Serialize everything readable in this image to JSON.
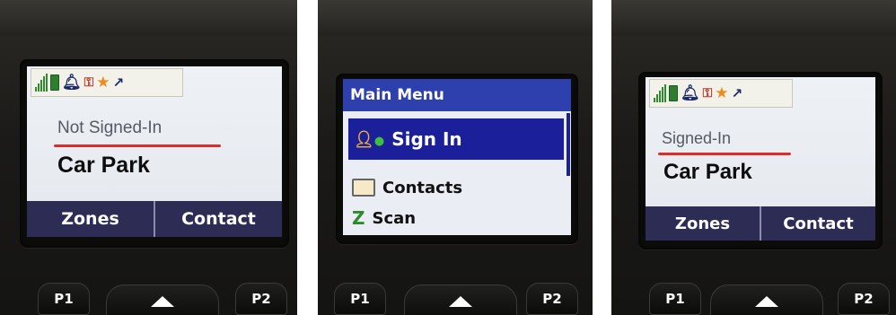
{
  "panels": [
    {
      "status_label": "Not Signed-In",
      "zone_name": "Car Park",
      "softkeys": [
        "Zones",
        "Contact"
      ],
      "keys": {
        "left": "P1",
        "right": "P2"
      }
    },
    {
      "menu_title": "Main Menu",
      "menu_items": [
        {
          "label": "Sign In",
          "icon": "sign-in-person-icon",
          "selected": true
        },
        {
          "label": "Contacts",
          "icon": "contacts-card-icon",
          "selected": false
        },
        {
          "label": "Scan",
          "icon": "scan-z-icon",
          "selected": false
        }
      ],
      "keys": {
        "left": "P1",
        "right": "P2"
      }
    },
    {
      "status_label": "Signed-In",
      "zone_name": "Car Park",
      "softkeys": [
        "Zones",
        "Contact"
      ],
      "keys": {
        "left": "P1",
        "right": "P2"
      }
    }
  ],
  "status_icons": [
    "signal-strength-icon",
    "battery-icon",
    "bell-icon",
    "key-crossed-icon",
    "star-icon",
    "satellite-icon"
  ],
  "colors": {
    "softkey_bar": "#2c2c55",
    "menu_header": "#2e3fae",
    "selected_item": "#1b1f9a",
    "annotation_underline": "#e02b2b",
    "star": "#f08a1c"
  }
}
